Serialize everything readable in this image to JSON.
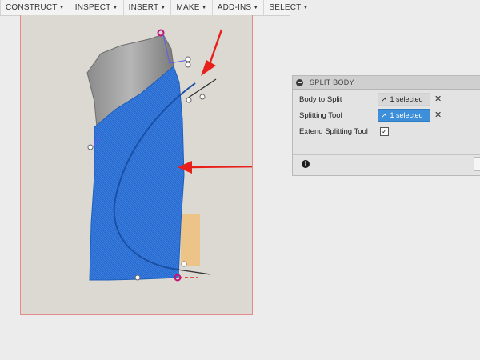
{
  "toolbar": {
    "items": [
      {
        "label": "CONSTRUCT"
      },
      {
        "label": "INSPECT"
      },
      {
        "label": "INSERT"
      },
      {
        "label": "MAKE"
      },
      {
        "label": "ADD-INS"
      },
      {
        "label": "SELECT"
      }
    ],
    "caret": "▼"
  },
  "panel": {
    "title": "SPLIT BODY",
    "rows": {
      "body_to_split": {
        "label": "Body to Split",
        "value": "1 selected"
      },
      "splitting_tool": {
        "label": "Splitting Tool",
        "value": "1 selected"
      },
      "extend_tool": {
        "label": "Extend Splitting Tool",
        "checked": "✓"
      }
    },
    "clear_glyph": "✕",
    "info_glyph": "i"
  },
  "icons": {
    "cursor": "arrow-cursor-icon",
    "info": "info-icon",
    "clear": "close-icon"
  },
  "colors": {
    "body_blue": "#2f74d6",
    "active_field": "#3c8fd8",
    "annotation_arrow": "#e8201c",
    "handle_magenta": "#c0147a"
  }
}
